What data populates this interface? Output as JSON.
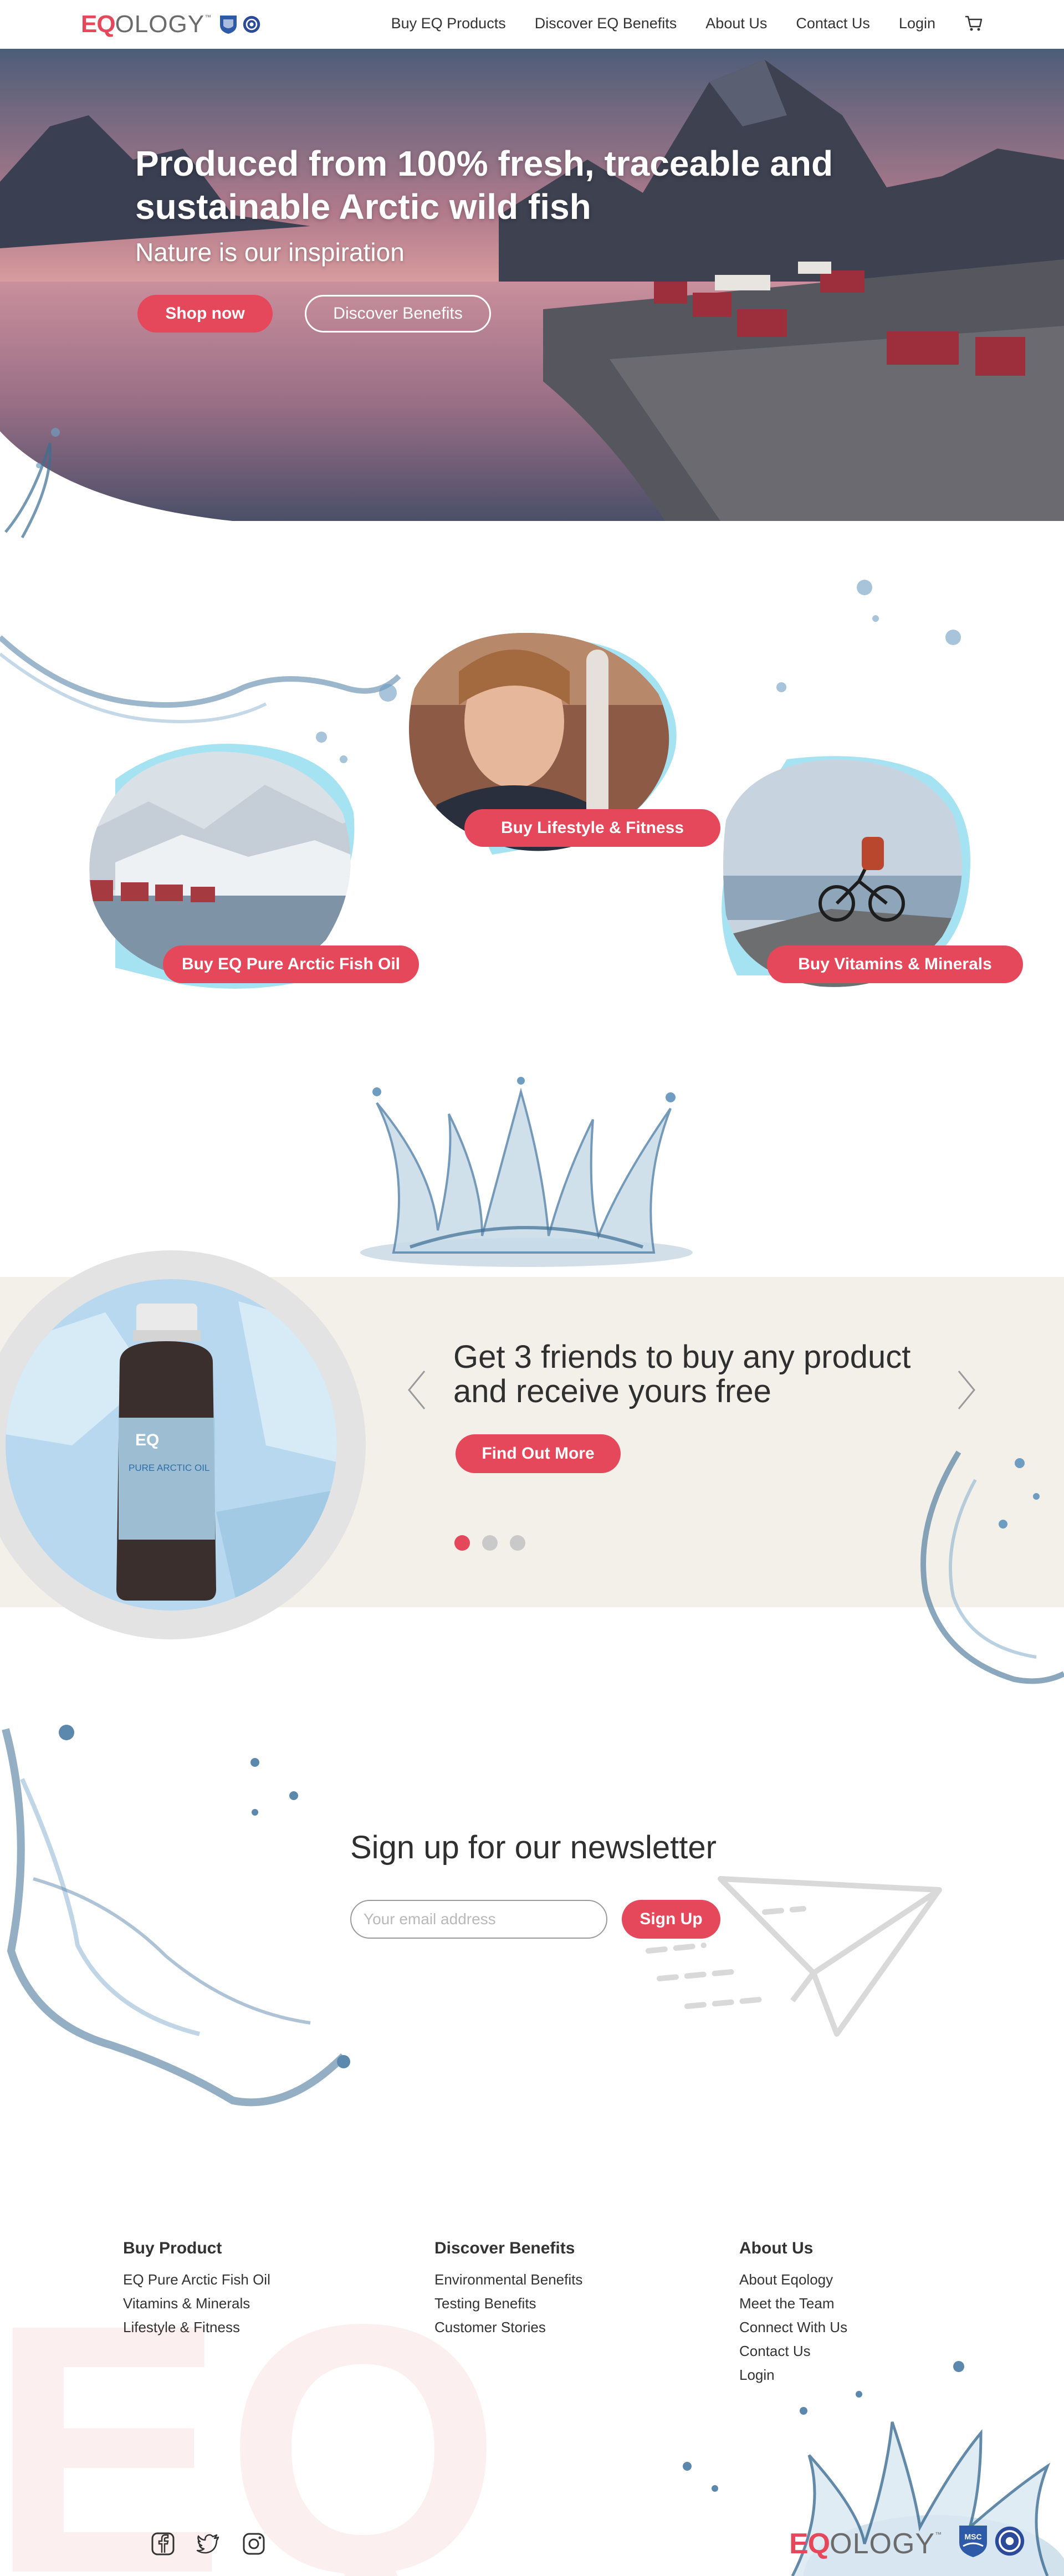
{
  "brand": {
    "eq": "EQ",
    "ology": "OLOGY",
    "tm": "™"
  },
  "nav": [
    {
      "label": "Buy EQ Products"
    },
    {
      "label": "Discover EQ Benefits"
    },
    {
      "label": "About Us"
    },
    {
      "label": "Contact Us"
    },
    {
      "label": "Login"
    }
  ],
  "hero": {
    "title": "Produced from 100% fresh, traceable and sustainable Arctic wild fish",
    "subtitle": "Nature is our inspiration",
    "shop_label": "Shop now",
    "discover_label": "Discover Benefits"
  },
  "categories": [
    {
      "label": "Buy EQ Pure Arctic Fish Oil"
    },
    {
      "label": "Buy Lifestyle & Fitness"
    },
    {
      "label": "Buy Vitamins & Minerals"
    }
  ],
  "promo": {
    "title": "Get 3 friends to buy any product and receive yours free",
    "button_label": "Find Out More",
    "bottle_brand": "EQ",
    "bottle_label": "PURE ARCTIC OIL",
    "active_slide": 1,
    "slide_count": 3
  },
  "newsletter": {
    "title": "Sign up for our newsletter",
    "placeholder": "Your email address",
    "button_label": "Sign Up"
  },
  "footer": {
    "columns": [
      {
        "heading": "Buy Product",
        "links": [
          "EQ Pure Arctic Fish Oil",
          "Vitamins & Minerals",
          "Lifestyle & Fitness"
        ]
      },
      {
        "heading": "Discover Benefits",
        "links": [
          "Environmental Benefits",
          "Testing Benefits",
          "Customer Stories"
        ]
      },
      {
        "heading": "About Us",
        "links": [
          "About Eqology",
          "Meet the Team",
          "Connect With Us",
          "Contact Us",
          "Login"
        ]
      }
    ],
    "watermark": "EQ",
    "social": [
      "facebook-icon",
      "twitter-icon",
      "instagram-icon"
    ],
    "badge_text": "MSC"
  },
  "colors": {
    "accent": "#e5485a",
    "promo_bg": "#f3f0ea",
    "blob_cyan": "#a6e3f2"
  }
}
